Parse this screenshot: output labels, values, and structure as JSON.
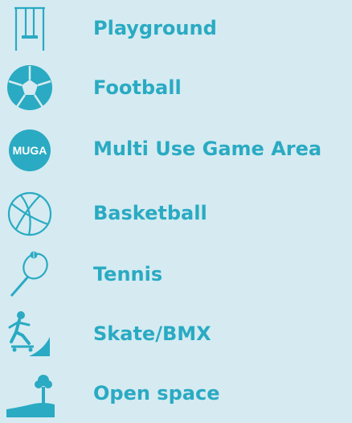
{
  "legend": {
    "items": [
      {
        "label": "Playground",
        "icon": "swing-icon"
      },
      {
        "label": "Football",
        "icon": "football-icon"
      },
      {
        "label": "Multi Use Game Area",
        "icon": "muga-icon",
        "icon_text": "MUGA"
      },
      {
        "label": "Basketball",
        "icon": "basketball-icon"
      },
      {
        "label": "Tennis",
        "icon": "tennis-racket-icon"
      },
      {
        "label": "Skate/BMX",
        "icon": "skateboarder-icon"
      },
      {
        "label": "Open space",
        "icon": "tree-hill-icon"
      }
    ]
  },
  "colors": {
    "background": "#d5ebf1",
    "accent": "#2aaac3",
    "icon_fill": "#2aaac3"
  }
}
